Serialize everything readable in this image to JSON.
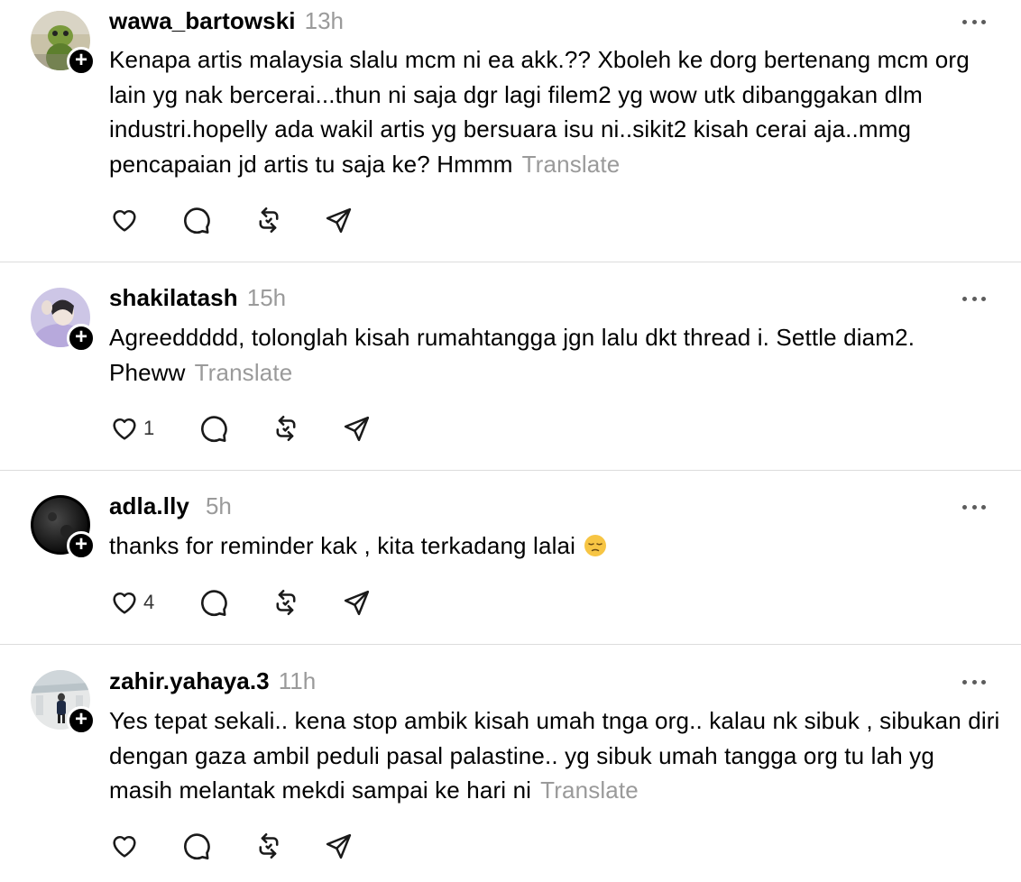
{
  "translate_label": "Translate",
  "posts": [
    {
      "username": "wawa_bartowski",
      "time": "13h",
      "text": "Kenapa artis malaysia slalu mcm ni ea akk.?? Xboleh ke dorg bertenang mcm org lain yg nak bercerai...thun ni saja dgr lagi filem2 yg wow utk dibanggakan dlm industri.hopelly ada wakil artis yg bersuara isu ni..sikit2 kisah cerai aja..mmg pencapaian jd artis tu saja ke? Hmmm",
      "like_count": ""
    },
    {
      "username": "shakilatash",
      "time": "15h",
      "text": "Agreeddddd, tolonglah kisah rumahtangga jgn lalu dkt thread i. Settle diam2. Pheww",
      "like_count": "1"
    },
    {
      "username": "adla.lly",
      "time": "5h",
      "text": "thanks for reminder kak , kita terkadang lalai",
      "like_count": "4"
    },
    {
      "username": "zahir.yahaya.3",
      "time": "11h",
      "text": "Yes tepat sekali.. kena stop ambik kisah umah tnga org.. kalau nk sibuk , sibukan diri dengan gaza ambil peduli pasal palastine.. yg sibuk umah tangga org tu lah yg masih melantak mekdi sampai ke hari ni",
      "like_count": ""
    }
  ],
  "icons": {
    "like": "heart-icon",
    "reply": "comment-icon",
    "repost": "repost-icon",
    "share": "send-icon",
    "more": "more-icon",
    "follow": "plus-icon"
  }
}
